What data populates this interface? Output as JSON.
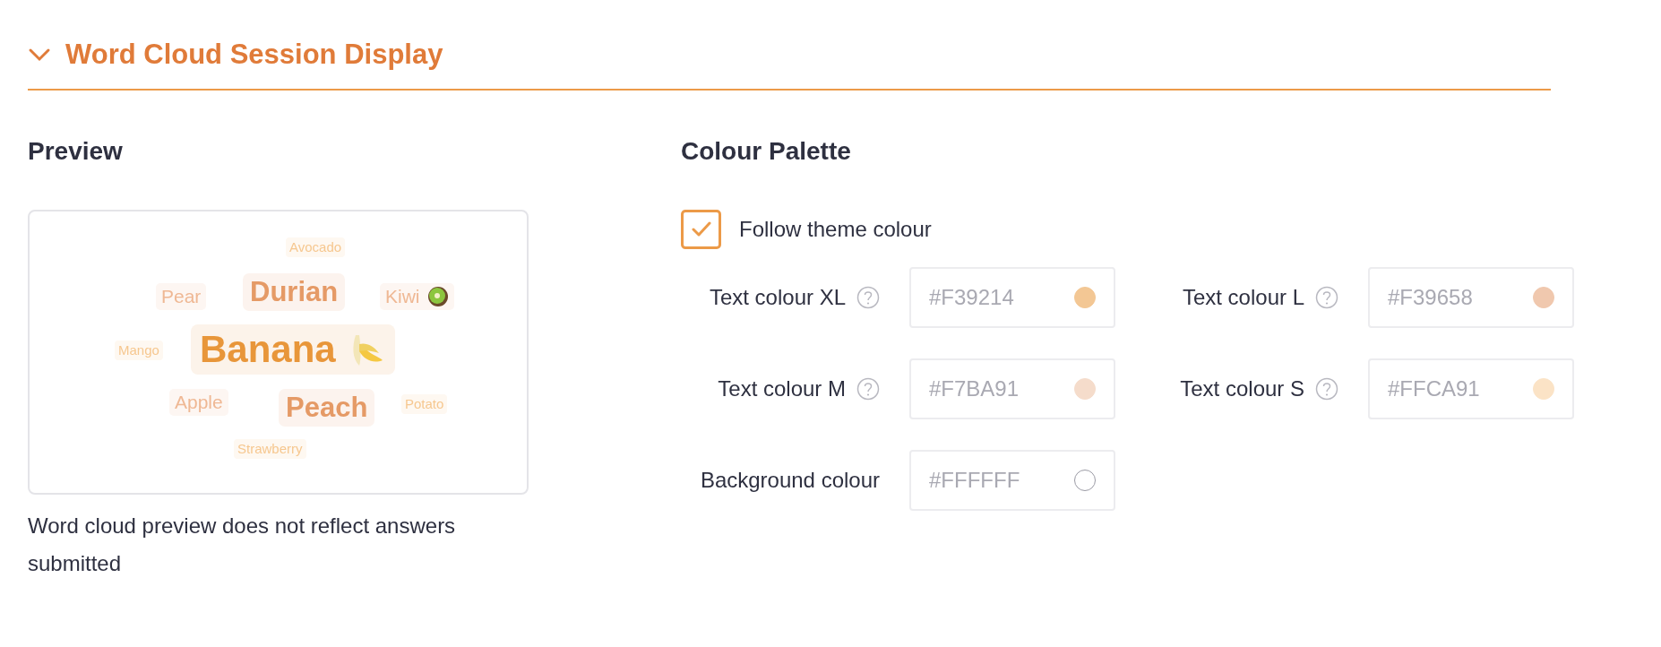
{
  "section": {
    "title": "Word Cloud Session Display",
    "expanded": true
  },
  "preview": {
    "heading": "Preview",
    "words": [
      {
        "text": "Avocado",
        "kind": "s"
      },
      {
        "text": "Pear",
        "kind": "m"
      },
      {
        "text": "Durian",
        "kind": "l"
      },
      {
        "text": "Kiwi",
        "kind": "m",
        "icon": true
      },
      {
        "text": "Mango",
        "kind": "s"
      },
      {
        "text": "Banana",
        "kind": "xl",
        "icon": true
      },
      {
        "text": "Apple",
        "kind": "m"
      },
      {
        "text": "Peach",
        "kind": "l"
      },
      {
        "text": "Potato",
        "kind": "s"
      },
      {
        "text": "Strawberry",
        "kind": "s"
      }
    ],
    "caption": "Word cloud preview does not reflect answers submitted"
  },
  "palette": {
    "heading": "Colour Palette",
    "follow_theme": {
      "label": "Follow theme colour",
      "checked": true
    },
    "fields": [
      {
        "label": "Text colour XL",
        "help": true,
        "value": "#F39214",
        "color": "#f3c794"
      },
      {
        "label": "Text colour L",
        "help": true,
        "value": "#F39658",
        "color": "#f0c8ae"
      },
      {
        "label": "Text colour M",
        "help": true,
        "value": "#F7BA91",
        "color": "#f5dccb"
      },
      {
        "label": "Text colour S",
        "help": true,
        "value": "#FFCA91",
        "color": "#fbe3c6"
      },
      {
        "label": "Background colour",
        "help": false,
        "value": "#FFFFFF",
        "color": "#ffffff"
      }
    ]
  }
}
